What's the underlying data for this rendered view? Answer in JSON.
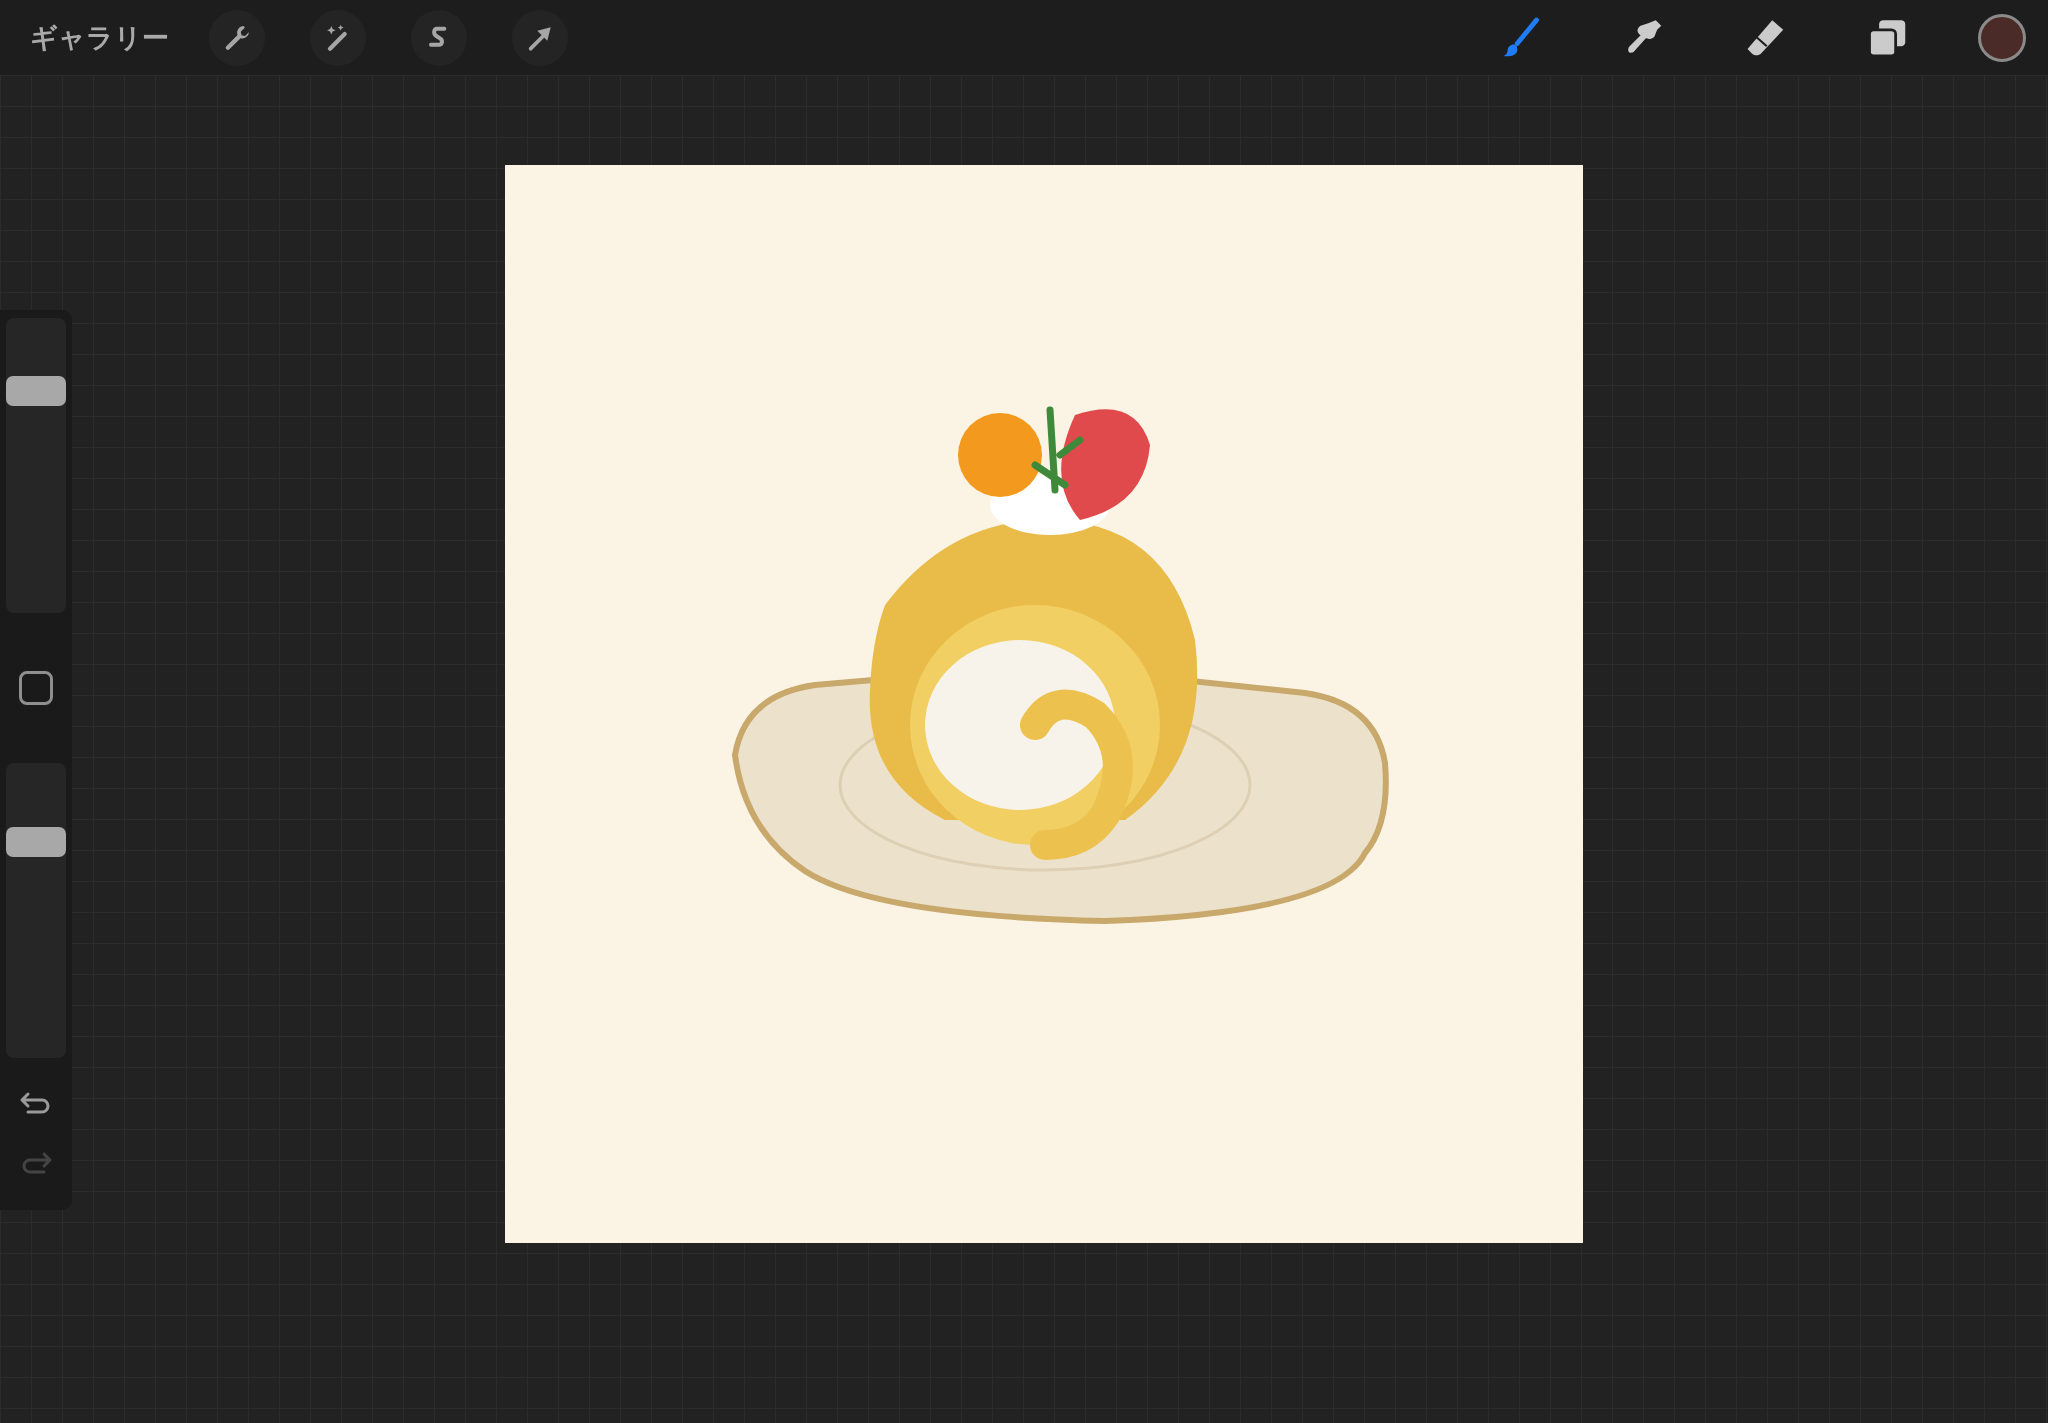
{
  "top_bar": {
    "gallery_label": "ギャラリー",
    "actions": [
      {
        "kind": "wrench"
      },
      {
        "kind": "wand"
      },
      {
        "kind": "selection"
      },
      {
        "kind": "transform"
      }
    ],
    "tools": [
      {
        "kind": "brush",
        "selected": true
      },
      {
        "kind": "smudge",
        "selected": false
      },
      {
        "kind": "eraser",
        "selected": false
      },
      {
        "kind": "layers",
        "selected": false
      }
    ],
    "color_swatch": {
      "color": "#4a2b27"
    }
  },
  "sidebar": {
    "size_slider": {
      "level": 0.78
    },
    "opacity_slider": {
      "level": 0.76
    },
    "undo": {
      "disabled": false
    },
    "redo": {
      "disabled": true
    }
  }
}
